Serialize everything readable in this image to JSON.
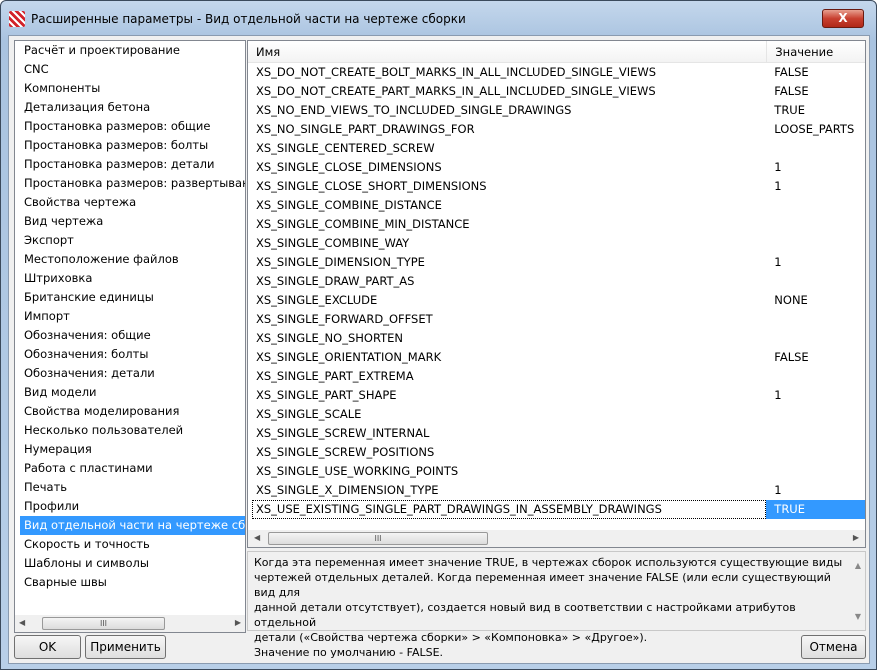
{
  "window": {
    "title": "Расширенные параметры - Вид отдельной части на чертеже сборки",
    "close": "X"
  },
  "categories": [
    "Расчёт и проектирование",
    "CNC",
    "Компоненты",
    "Детализация бетона",
    "Простановка размеров: общие",
    "Простановка размеров: болты",
    "Простановка размеров: детали",
    "Простановка размеров: развертывание",
    "Свойства чертежа",
    "Вид чертежа",
    "Экспорт",
    "Местоположение файлов",
    "Штриховка",
    "Британские единицы",
    "Импорт",
    "Обозначения: общие",
    "Обозначения: болты",
    "Обозначения: детали",
    "Вид модели",
    "Свойства моделирования",
    "Несколько пользователей",
    "Нумерация",
    "Работа с пластинами",
    "Печать",
    "Профили",
    "Вид отдельной части на чертеже сборки",
    "Скорость и точность",
    "Шаблоны и символы",
    "Сварные швы"
  ],
  "selected_category_index": 25,
  "table": {
    "headers": {
      "name": "Имя",
      "value": "Значение"
    },
    "rows": [
      {
        "name": "XS_DO_NOT_CREATE_BOLT_MARKS_IN_ALL_INCLUDED_SINGLE_VIEWS",
        "value": "FALSE"
      },
      {
        "name": "XS_DO_NOT_CREATE_PART_MARKS_IN_ALL_INCLUDED_SINGLE_VIEWS",
        "value": "FALSE"
      },
      {
        "name": "XS_NO_END_VIEWS_TO_INCLUDED_SINGLE_DRAWINGS",
        "value": "TRUE"
      },
      {
        "name": "XS_NO_SINGLE_PART_DRAWINGS_FOR",
        "value": "LOOSE_PARTS"
      },
      {
        "name": "XS_SINGLE_CENTERED_SCREW",
        "value": ""
      },
      {
        "name": "XS_SINGLE_CLOSE_DIMENSIONS",
        "value": "1"
      },
      {
        "name": "XS_SINGLE_CLOSE_SHORT_DIMENSIONS",
        "value": "1"
      },
      {
        "name": "XS_SINGLE_COMBINE_DISTANCE",
        "value": ""
      },
      {
        "name": "XS_SINGLE_COMBINE_MIN_DISTANCE",
        "value": ""
      },
      {
        "name": "XS_SINGLE_COMBINE_WAY",
        "value": ""
      },
      {
        "name": "XS_SINGLE_DIMENSION_TYPE",
        "value": "1"
      },
      {
        "name": "XS_SINGLE_DRAW_PART_AS",
        "value": ""
      },
      {
        "name": "XS_SINGLE_EXCLUDE",
        "value": "NONE"
      },
      {
        "name": "XS_SINGLE_FORWARD_OFFSET",
        "value": ""
      },
      {
        "name": "XS_SINGLE_NO_SHORTEN",
        "value": ""
      },
      {
        "name": "XS_SINGLE_ORIENTATION_MARK",
        "value": "FALSE"
      },
      {
        "name": "XS_SINGLE_PART_EXTREMA",
        "value": ""
      },
      {
        "name": "XS_SINGLE_PART_SHAPE",
        "value": "1"
      },
      {
        "name": "XS_SINGLE_SCALE",
        "value": ""
      },
      {
        "name": "XS_SINGLE_SCREW_INTERNAL",
        "value": ""
      },
      {
        "name": "XS_SINGLE_SCREW_POSITIONS",
        "value": ""
      },
      {
        "name": "XS_SINGLE_USE_WORKING_POINTS",
        "value": ""
      },
      {
        "name": "XS_SINGLE_X_DIMENSION_TYPE",
        "value": "1"
      },
      {
        "name": "XS_USE_EXISTING_SINGLE_PART_DRAWINGS_IN_ASSEMBLY_DRAWINGS",
        "value": "TRUE"
      }
    ],
    "selected_row_index": 23
  },
  "description": "Когда эта переменная имеет значение TRUE, в чертежах сборок используются существующие виды\nчертежей отдельных деталей. Когда переменная имеет значение FALSE (или если существующий вид для\nданной детали отсутствует), создается новый вид в соответствии с настройками атрибутов отдельной\nдетали («Свойства чертежа сборки» > «Компоновка» > «Другое»).\nЗначение по умолчанию - FALSE.",
  "buttons": {
    "ok": "OK",
    "apply": "Применить",
    "cancel": "Отмена"
  }
}
